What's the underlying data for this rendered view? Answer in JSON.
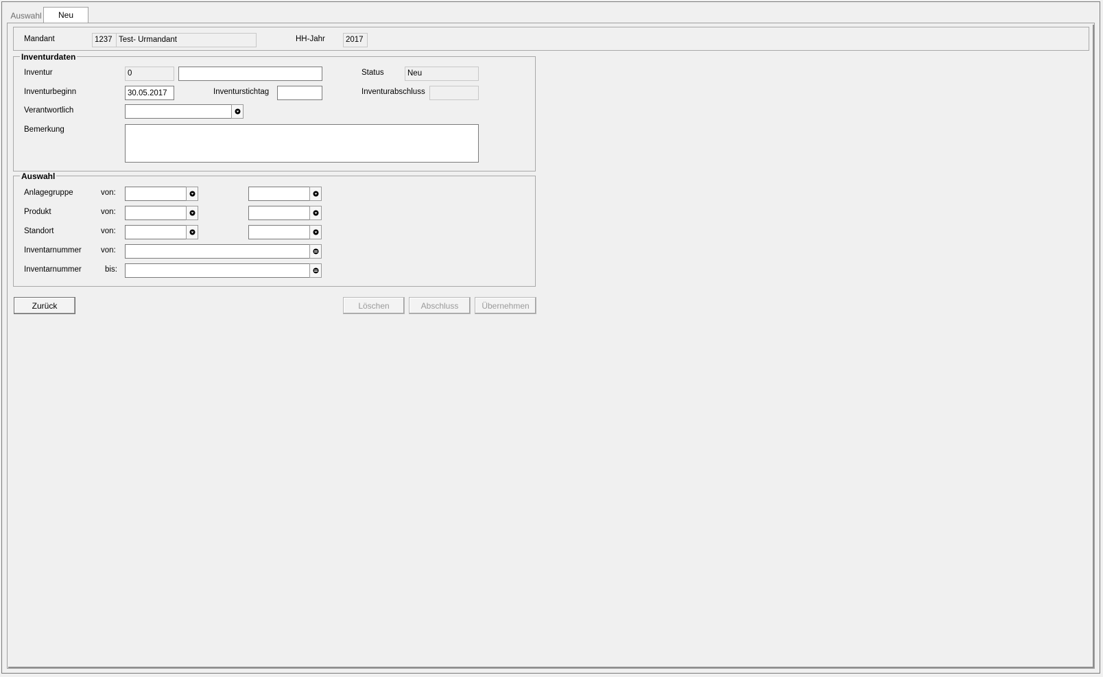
{
  "tabs": [
    {
      "label": "Auswahl"
    },
    {
      "label": "Neu"
    }
  ],
  "header": {
    "mandant_label": "Mandant",
    "mandant_id": "1237",
    "mandant_name": "Test- Urmandant",
    "year_label": "HH-Jahr",
    "year_value": "2017"
  },
  "inventurdaten": {
    "title": "Inventurdaten",
    "inventur_label": "Inventur",
    "inventur_number": "0",
    "inventur_name": "",
    "status_label": "Status",
    "status_value": "Neu",
    "beginn_label": "Inventurbeginn",
    "beginn_value": "30.05.2017",
    "stichtag_label": "Inventurstichtag",
    "stichtag_value": "",
    "abschluss_label": "Inventurabschluss",
    "abschluss_value": "",
    "verantwortlich_label": "Verantwortlich",
    "verantwortlich_value": "",
    "bemerkung_label": "Bemerkung",
    "bemerkung_value": ""
  },
  "auswahl": {
    "title": "Auswahl",
    "rows": [
      {
        "label": "Anlagegruppe",
        "qualifier": "von:"
      },
      {
        "label": "Produkt",
        "qualifier": "von:"
      },
      {
        "label": "Standort",
        "qualifier": "von:"
      },
      {
        "label": "Inventarnummer",
        "qualifier": "von:"
      },
      {
        "label": "Inventarnummer",
        "qualifier": "bis:"
      }
    ]
  },
  "buttons": {
    "back": "Zurück",
    "delete": "Löschen",
    "close": "Abschluss",
    "apply": "Übernehmen"
  },
  "icons": {
    "lookup": "arrow-down-circle-icon",
    "search": "search-circle-icon"
  }
}
